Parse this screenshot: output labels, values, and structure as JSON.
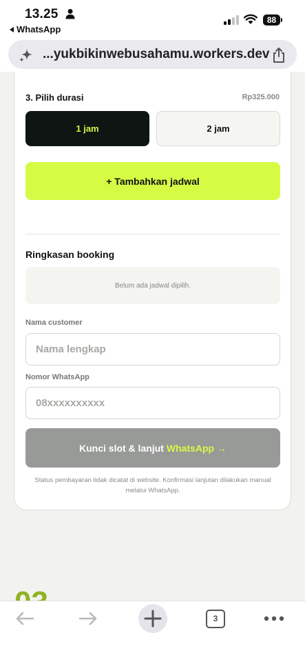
{
  "status_bar": {
    "time": "13.25",
    "back_app": "WhatsApp",
    "battery": "88"
  },
  "browser": {
    "url": "...yukbikinwebusahamu.workers.dev",
    "tab_count": "3"
  },
  "booking": {
    "section_title": "3. Pilih durasi",
    "price": "Rp325.000",
    "durations": [
      {
        "label": "1 jam",
        "selected": true
      },
      {
        "label": "2 jam",
        "selected": false
      }
    ],
    "add_schedule_label": "+ Tambahkan jadwal",
    "summary_title": "Ringkasan booking",
    "summary_empty": "Belum ada jadwal dipilih.",
    "name_label": "Nama customer",
    "name_placeholder": "Nama lengkap",
    "name_value": "",
    "whatsapp_label": "Nomor WhatsApp",
    "whatsapp_placeholder": "08xxxxxxxxxx",
    "whatsapp_value": "",
    "submit_label": "Kunci slot & lanjut",
    "submit_accent": "WhatsApp →",
    "footnote": "Status pembayaran tidak dicatat di website. Konfirmasi lanjutan dilakukan manual melalui WhatsApp."
  },
  "peek_number": "03",
  "colors": {
    "accent_lime": "#d5fb45",
    "dark_button": "#0f1512",
    "disabled_button": "#979a97",
    "peek_green": "#8fb321"
  },
  "icons": {
    "status": [
      "person-icon",
      "signal-icon",
      "wifi-icon",
      "battery-icon"
    ],
    "url_bar": [
      "sparkle-icon",
      "share-icon"
    ],
    "toolbar": [
      "back-arrow-icon",
      "forward-arrow-icon",
      "plus-icon",
      "tabs-icon",
      "more-icon"
    ]
  }
}
